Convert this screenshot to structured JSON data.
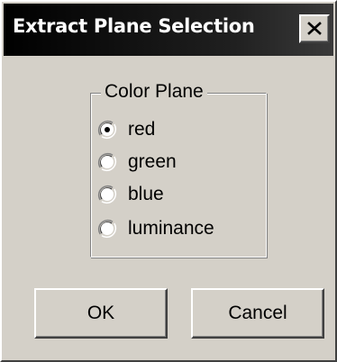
{
  "window": {
    "title": "Extract Plane Selection",
    "close_icon": "close-icon"
  },
  "group": {
    "label": "Color Plane",
    "options": [
      {
        "label": "red",
        "selected": true
      },
      {
        "label": "green",
        "selected": false
      },
      {
        "label": "blue",
        "selected": false
      },
      {
        "label": "luminance",
        "selected": false
      }
    ]
  },
  "buttons": {
    "ok_label": "OK",
    "cancel_label": "Cancel"
  }
}
